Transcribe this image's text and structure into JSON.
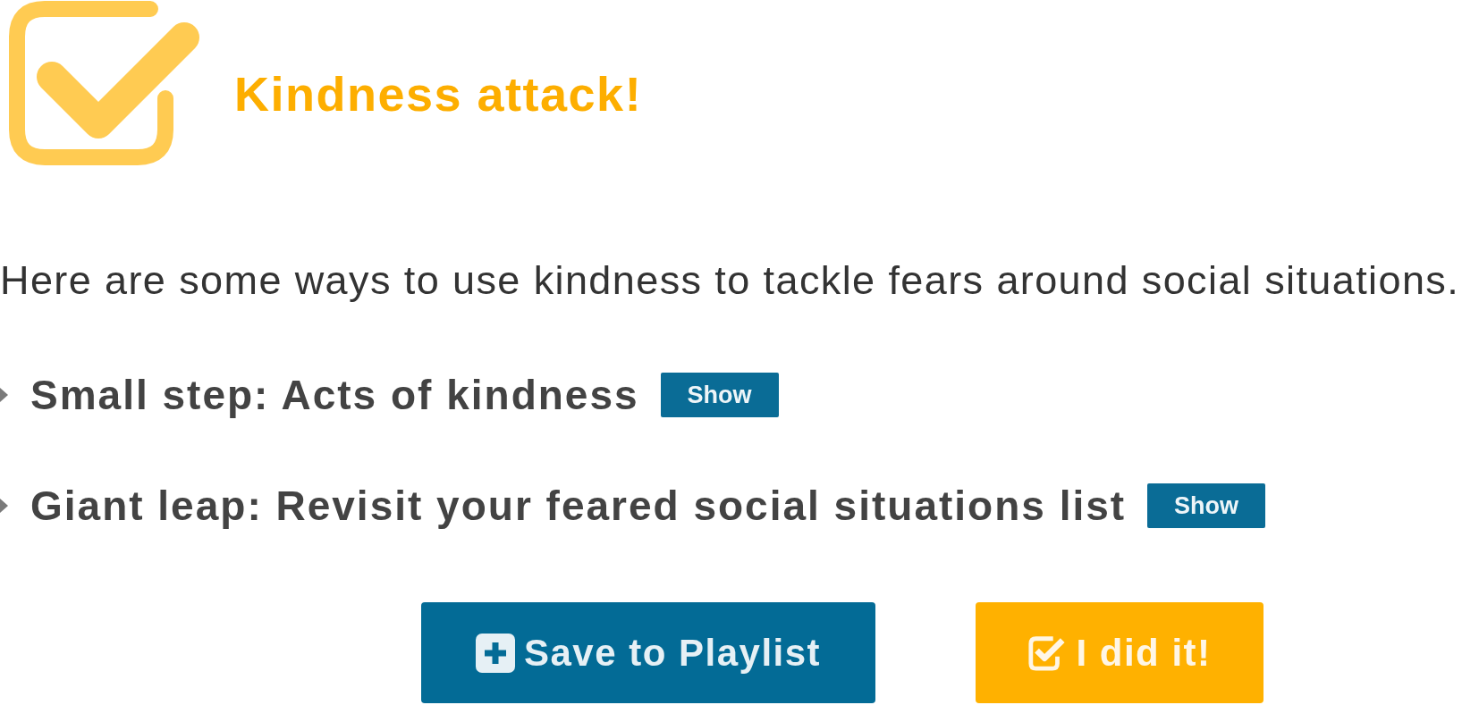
{
  "header": {
    "title": "Kindness attack!"
  },
  "intro": "Here are some ways to use kindness to tackle fears around social situations.",
  "steps": [
    {
      "label": "Small step: Acts of kindness",
      "expanded": false,
      "button": "Show"
    },
    {
      "label": "Giant leap: Revisit your feared social situations list",
      "expanded": false,
      "button": "Show"
    }
  ],
  "actions": [
    {
      "kind": "save",
      "label": "Save to Playlist"
    },
    {
      "kind": "done",
      "label": "I did it!"
    }
  ]
}
